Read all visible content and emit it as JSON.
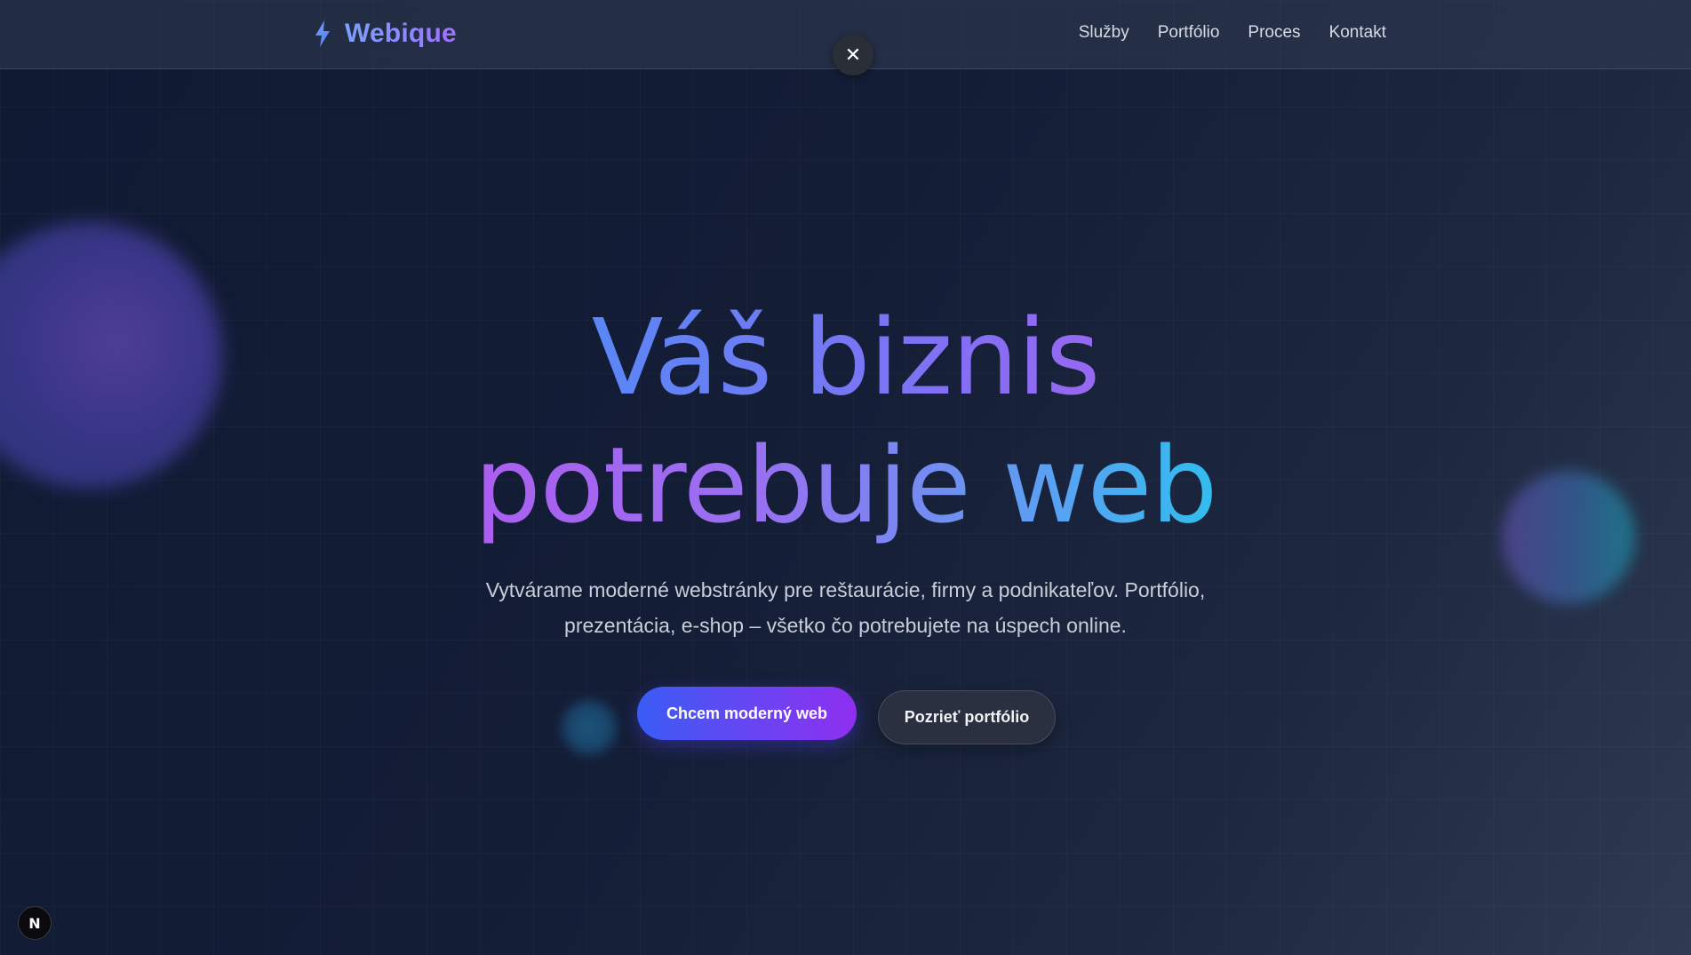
{
  "header": {
    "logo_text": "Webique",
    "logo_icon": "lightning-bolt-icon",
    "nav": [
      {
        "label": "Služby"
      },
      {
        "label": "Portfólio"
      },
      {
        "label": "Proces"
      },
      {
        "label": "Kontakt"
      }
    ],
    "close_icon": "close-icon",
    "close_glyph": "✕"
  },
  "hero": {
    "title_line1": "Váš biznis",
    "title_line2": "potrebuje web",
    "subtitle_line1": "Vytvárame moderné webstránky pre reštaurácie, firmy a podnikateľov. Portfólio,",
    "subtitle_line2": "prezentácia, e-shop – všetko čo potrebujete na úspech online.",
    "primary_button": "Chcem moderný web",
    "secondary_button": "Pozrieť portfólio"
  },
  "dev_badge": {
    "label": "N",
    "icon": "nextjs-icon"
  },
  "colors": {
    "brand_blue": "#4f8cf7",
    "brand_purple": "#a855f7",
    "brand_cyan": "#19d0ea",
    "background": "#141d36"
  }
}
